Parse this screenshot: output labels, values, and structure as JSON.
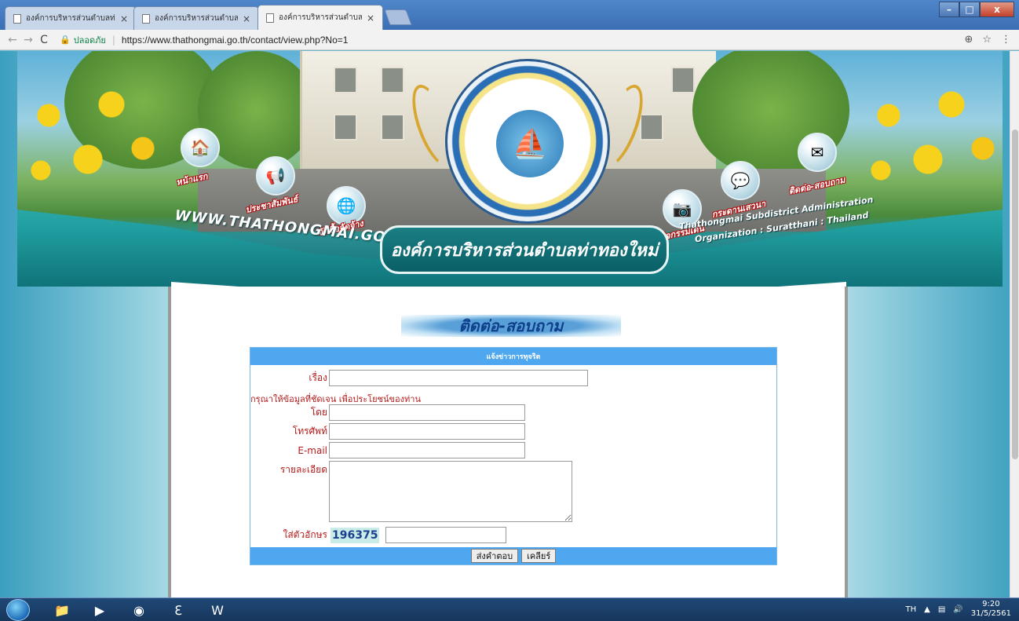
{
  "browser": {
    "tabs": [
      {
        "title": "องค์การบริหารส่วนตำบลท่าท",
        "close": "×"
      },
      {
        "title": "องค์การบริหารส่วนตำบลท่าท",
        "close": "×"
      },
      {
        "title": "องค์การบริหารส่วนตำบลท่าท",
        "close": "×"
      }
    ],
    "window_buttons": {
      "minimize": "–",
      "maximize": "□",
      "close": "x"
    },
    "nav": {
      "back": "←",
      "forward": "→",
      "reload": "C"
    },
    "security_label": "ปลอดภัย",
    "url": "https://www.thathongmai.go.th/contact/view.php?No=1",
    "addr_icons": {
      "zoom": "⊕",
      "star": "☆",
      "menu": "⋮"
    }
  },
  "banner": {
    "nav_items": [
      {
        "label": "หน้าแรก"
      },
      {
        "label": "ประชาสัมพันธ์"
      },
      {
        "label": "จัดซื้อจัดจ้าง"
      },
      {
        "label": "กิจกรรมเด่น"
      },
      {
        "label": "กระดานเสวนา"
      },
      {
        "label": "ติดต่อ-สอบถาม"
      }
    ],
    "website": "WWW.THATHONGMAI.GO.TH",
    "org_name_th": "องค์การบริหารส่วนตำบลท่าทองใหม่",
    "org_name_en_line1": "Thathongmai Subdistrict Administration",
    "org_name_en_line2": "Organization : Suratthani : Thailand"
  },
  "content": {
    "section_title": "ติดต่อ-สอบถาม",
    "form": {
      "header": "แจ้งข่าวการทุจริต",
      "subject_label": "เรื่อง",
      "subject_value": "",
      "note": "กรุณาให้ข้อมูลที่ชัดเจน เพื่อประโยชน์ของท่าน",
      "by_label": "โดย",
      "by_value": "",
      "phone_label": "โทรศัพท์",
      "phone_value": "",
      "email_label": "E-mail",
      "email_value": "",
      "detail_label": "รายละเอียด",
      "detail_value": "",
      "captcha_label": "ใส่ตัวอักษร",
      "captcha_code": "196375",
      "captcha_value": "",
      "submit_label": "ส่งคำตอบ",
      "clear_label": "เคลียร์"
    }
  },
  "taskbar": {
    "language": "TH",
    "time": "9:20",
    "date": "31/5/2561"
  },
  "colors": {
    "form_header": "#4ea7ef",
    "label_red": "#b51a1a",
    "captcha_bg": "#c9ece8"
  }
}
